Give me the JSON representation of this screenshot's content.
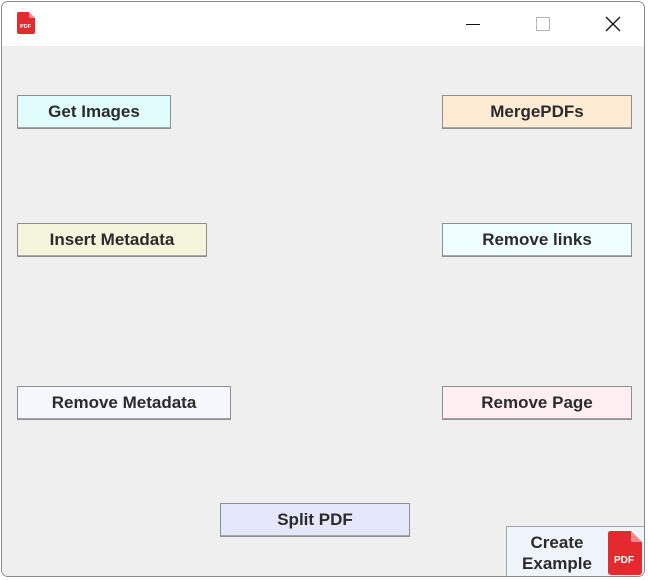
{
  "window": {
    "minimize_icon": "minimize-icon",
    "maximize_icon": "maximize-icon",
    "close_icon": "close-icon",
    "app_icon": "pdf-file-icon",
    "app_icon_text": "PDF"
  },
  "buttons": {
    "get_images": {
      "label": "Get Images",
      "color": "#e0fcfd"
    },
    "merge_pdfs": {
      "label": "MergePDFs",
      "color": "#fdebd3"
    },
    "insert_metadata": {
      "label": "Insert Metadata",
      "color": "#f5f5dd"
    },
    "remove_links": {
      "label": "Remove links",
      "color": "#effefe"
    },
    "remove_metadata": {
      "label": "Remove Metadata",
      "color": "#f6f7fc"
    },
    "remove_page": {
      "label": "Remove Page",
      "color": "#fdeef2"
    },
    "split_pdf": {
      "label": "Split PDF",
      "color": "#e5e7fa"
    }
  },
  "create_example": {
    "line1": "Create",
    "line2": "Example",
    "icon": "pdf-file-icon",
    "icon_text": "PDF"
  },
  "colors": {
    "pdf_red": "#e42a2f",
    "client_bg": "#efefef"
  }
}
